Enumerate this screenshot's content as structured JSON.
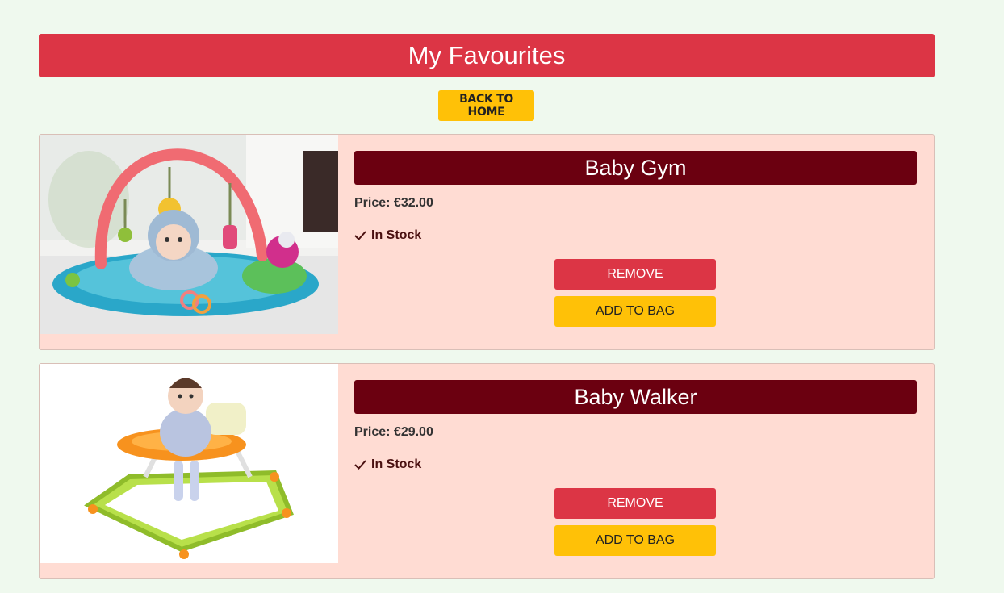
{
  "page": {
    "title": "My Favourites",
    "back_button": "BACK TO HOME"
  },
  "items": [
    {
      "name": "Baby Gym",
      "price": "Price: €32.00",
      "stock": "In Stock",
      "remove_label": "REMOVE",
      "add_label": "ADD TO BAG"
    },
    {
      "name": "Baby Walker",
      "price": "Price: €29.00",
      "stock": "In Stock",
      "remove_label": "REMOVE",
      "add_label": "ADD TO BAG"
    }
  ],
  "icons": {
    "stock": "check-icon"
  },
  "colors": {
    "background": "#eff9ee",
    "title_bar": "#dc3545",
    "card": "#ffdcd3",
    "product_title_bar": "#6b0010",
    "remove": "#dc3545",
    "add_to_bag": "#ffc107"
  }
}
